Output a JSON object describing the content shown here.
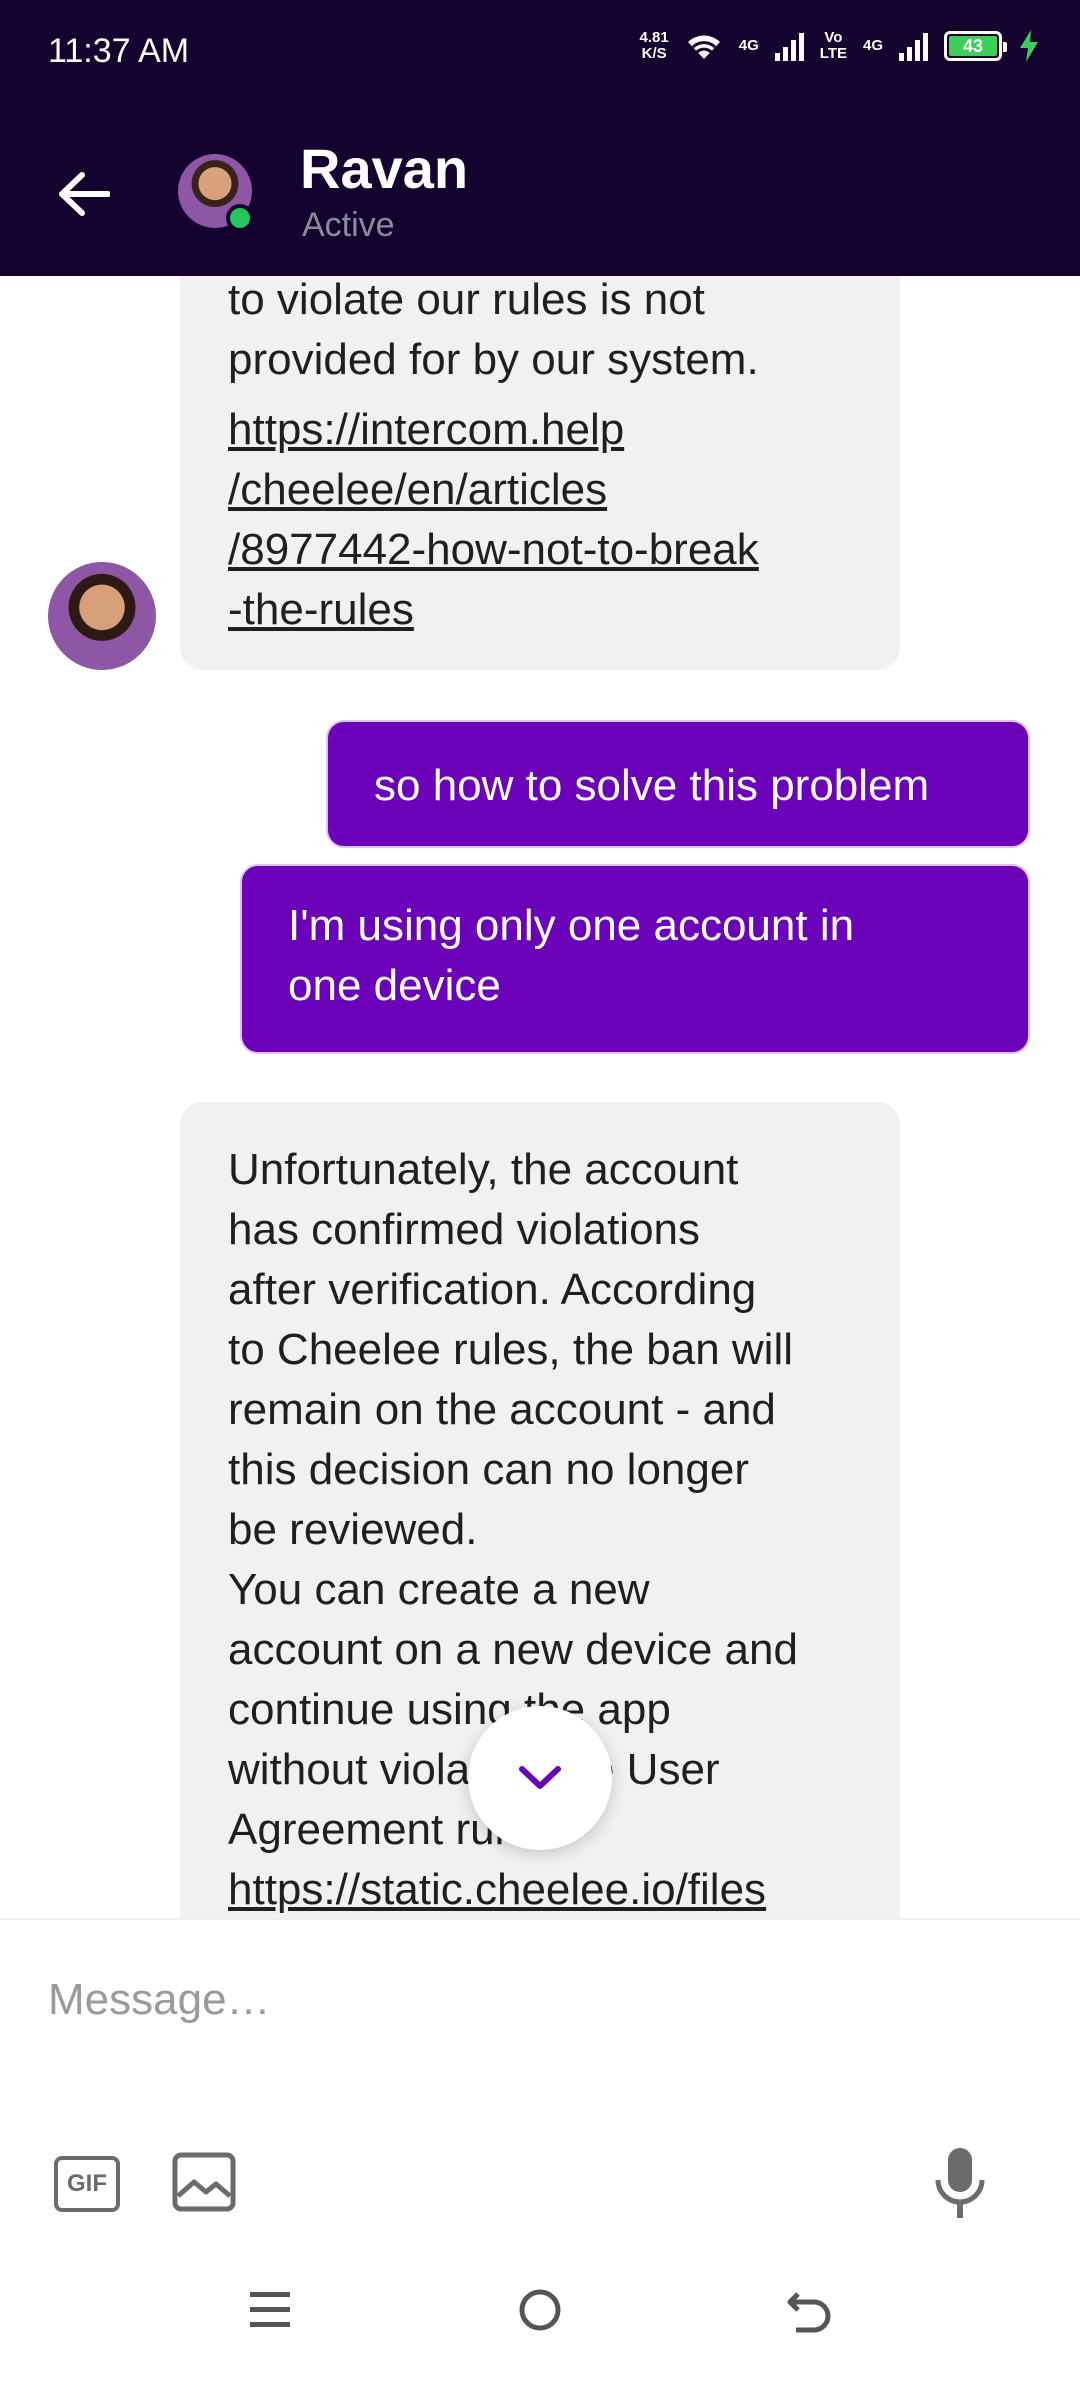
{
  "status_bar": {
    "time": "11:37 AM",
    "net_speed_value": "4.81",
    "net_speed_unit": "K/S",
    "signal1_label": "4G",
    "volte_label_top": "Vo",
    "volte_label_bottom": "LTE",
    "signal2_label": "4G",
    "battery_level": "43"
  },
  "header": {
    "contact_name": "Ravan",
    "contact_status": "Active",
    "back_icon": "arrow-left-icon"
  },
  "messages": {
    "incoming_1": {
      "text_line1": "to violate our rules is not",
      "text_line2": "provided for by our system.",
      "link_line1": "https://intercom.help",
      "link_line2": "/cheelee/en/articles",
      "link_line3": "/8977442-how-not-to-break",
      "link_line4": "-the-rules"
    },
    "outgoing_1": "so how to solve this problem",
    "outgoing_2_line1": "I'm using only one account in",
    "outgoing_2_line2": "one device",
    "incoming_2": {
      "lines": [
        "Unfortunately, the account",
        "has confirmed violations",
        "after verification. According",
        "to Cheelee rules, the ban will",
        "remain on the account - and",
        "this decision can no longer",
        "be reviewed.",
        "You can create a new",
        "account on a new device and",
        "continue using the app",
        "without violating the User",
        "Agreement rules."
      ],
      "link": "https://static.cheelee.io/files"
    }
  },
  "composer": {
    "placeholder": "Message…",
    "gif_label": "GIF"
  },
  "colors": {
    "header_bg": "#13032e",
    "outgoing_bubble": "#6b02b9",
    "incoming_bubble": "#f1f1f1",
    "online": "#22c55e"
  }
}
